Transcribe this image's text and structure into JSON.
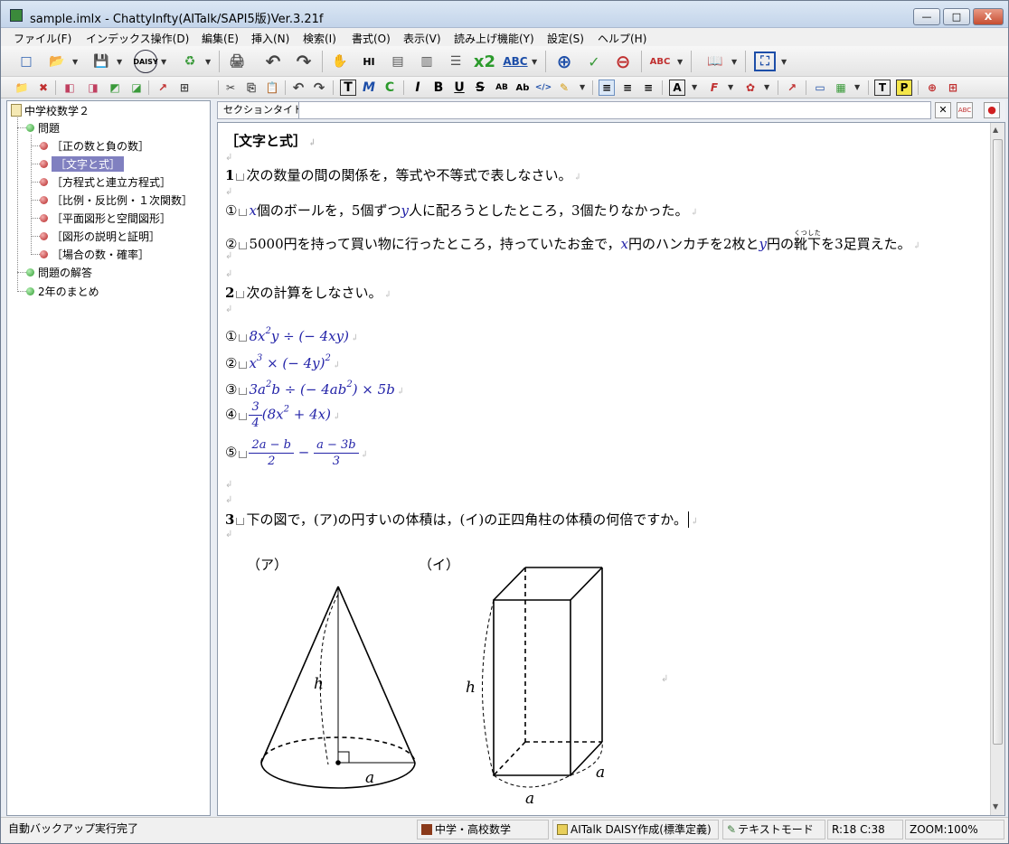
{
  "window": {
    "title": "sample.imlx - ChattyInfty(AITalk/SAPI5版)Ver.3.21f",
    "min_glyph": "—",
    "max_glyph": "□",
    "close_glyph": "X"
  },
  "menu": [
    "ファイル(F)",
    "インデックス操作(D)",
    "編集(E)",
    "挿入(N)",
    "検索(I)",
    "書式(O)",
    "表示(V)",
    "読み上げ機能(Y)",
    "設定(S)",
    "ヘルプ(H)"
  ],
  "toolbar1": {
    "new": "□",
    "open": "📂",
    "save": "💾",
    "daisy": "DAISY",
    "export": "♻",
    "print": "🖨",
    "undo": "↶",
    "redo": "↷",
    "person": "✋",
    "hl": "HI",
    "speak1": "▤",
    "speak2": "▥",
    "list": "☰",
    "x2": "x2",
    "abc": "ABC",
    "zoom_in": "⊕",
    "zoom_check": "✓",
    "zoom_out": "⊖",
    "spell": "ABC",
    "read": "📖",
    "screen": "⛶"
  },
  "toolbar2": {
    "i1": "📁",
    "i2": "✖",
    "i3": "◧",
    "i4": "◨",
    "i5": "◩",
    "i6": "◪",
    "i7": "↗",
    "i8": "⊞",
    "cut": "✂",
    "copy": "⎘",
    "paste": "📋",
    "undo": "↶",
    "redo": "↷",
    "t": "T",
    "m": "M",
    "c": "C",
    "italic": "I",
    "bold": "B",
    "underline": "U",
    "strike": "S",
    "sup": "AB",
    "size": "Ab",
    "tag": "</>",
    "ann": "✎",
    "al": "≡",
    "ac": "≡",
    "ar": "≡",
    "font": "A",
    "fx": "F",
    "color": "✿",
    "img1": "↗",
    "img2": "▭",
    "img3": "▦",
    "tt": "T",
    "pp": "P",
    "ins1": "⊕",
    "ins2": "⊞"
  },
  "tree": {
    "root": "中学校数学２",
    "nodes": [
      {
        "label": "問題",
        "level": 1,
        "status": "green"
      },
      {
        "label": "［正の数と負の数］",
        "level": 2,
        "status": "red"
      },
      {
        "label": "［文字と式］",
        "level": 2,
        "status": "red",
        "selected": true
      },
      {
        "label": "［方程式と連立方程式］",
        "level": 2,
        "status": "red"
      },
      {
        "label": "［比例・反比例・１次関数］",
        "level": 2,
        "status": "red"
      },
      {
        "label": "［平面図形と空間図形］",
        "level": 2,
        "status": "red"
      },
      {
        "label": "［図形の説明と証明］",
        "level": 2,
        "status": "red"
      },
      {
        "label": "［場合の数・確率］",
        "level": 2,
        "status": "red"
      },
      {
        "label": "問題の解答",
        "level": 1,
        "status": "green"
      },
      {
        "label": "2年のまとめ",
        "level": 1,
        "status": "green"
      }
    ]
  },
  "section": {
    "label": "セクションタイトル",
    "value": "",
    "btn_x": "✕",
    "btn_abc": "ABC",
    "btn_stop": "●"
  },
  "doc": {
    "title": "［文字と式］",
    "q1": {
      "num": "1",
      "text": "次の数量の間の関係を，等式や不等式で表しなさい。"
    },
    "q1_1": {
      "mark": "①",
      "pre": "x",
      "text": "個のボールを，5個ずつ",
      "y": "y",
      "text2": "人に配ろうとしたところ，3個たりなかった。"
    },
    "q1_2": {
      "mark": "②",
      "pre": "5000円を持って買い物に行ったところ，持っていたお金で，",
      "x": "x",
      "text": "円のハンカチを2枚と",
      "y": "y",
      "text2": "円の",
      "ruby_base": "靴下",
      "ruby": "くつした",
      "text3": "を3足買えた。"
    },
    "q2": {
      "num": "2",
      "text": "次の計算をしなさい。"
    },
    "e1": {
      "mark": "①",
      "a": "8x",
      "b": "y ÷ (− 4xy)",
      "sup": "2"
    },
    "e2": {
      "mark": "②",
      "a": "x",
      "b": " × (− 4y)",
      "sup1": "3",
      "sup2": "2"
    },
    "e3": {
      "mark": "③",
      "a": "3a",
      "b": "b ÷ (− 4ab",
      "c": ") × 5b",
      "sup1": "2",
      "sup2": "2"
    },
    "e4": {
      "mark": "④",
      "num": "3",
      "den": "4",
      "b": "(8x",
      "c": " + 4x)",
      "sup": "2"
    },
    "e5": {
      "mark": "⑤",
      "n1": "2a − b",
      "d1": "2",
      "op": "−",
      "n2": "a − 3b",
      "d2": "3"
    },
    "q3": {
      "num": "3",
      "text": "下の図で，(ア)の円すいの体積は，(イ)の正四角柱の体積の何倍ですか。"
    },
    "fig": {
      "a_label": "（ア）",
      "b_label": "（イ）",
      "h": "h",
      "a": "a"
    }
  },
  "status": {
    "left": "自動バックアップ実行完了",
    "mode1": "中学・高校数学",
    "mode2": "AITalk DAISY作成(標準定義)",
    "mode3": "テキストモード",
    "pos": "R:18 C:38",
    "zoom": "ZOOM:100%"
  }
}
